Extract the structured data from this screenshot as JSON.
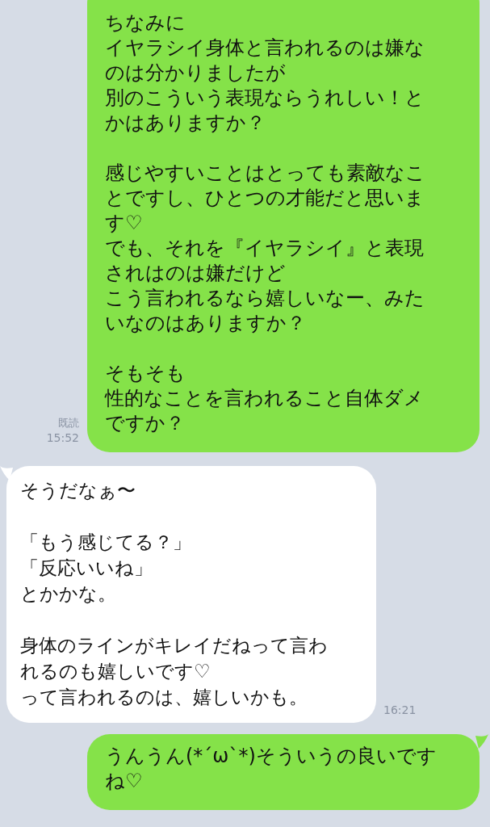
{
  "messages": [
    {
      "kind": "outgoing",
      "paragraphs": [
        [
          "ちなみに",
          "イヤラシイ身体と言われるのは嫌なのは分かりましたが",
          "別のこういう表現ならうれしい！とかはありますか？"
        ],
        [
          "感じやすいことはとっても素敵なことですし、ひとつの才能だと思います♡",
          "でも、それを『イヤラシイ』と表現されはのは嫌だけど",
          "こう言われるなら嬉しいなー、みたいなのはありますか？"
        ],
        [
          "そもそも",
          "性的なことを言われること自体ダメですか？"
        ]
      ],
      "read": "既読",
      "time": "15:52",
      "tail": false
    },
    {
      "kind": "incoming",
      "paragraphs": [
        [
          "そうだなぁ〜"
        ],
        [
          "「もう感じてる？」",
          "「反応いいね」",
          "とかかな。"
        ],
        [
          "身体のラインがキレイだねって言われるのも嬉しいです♡",
          "って言われるのは、嬉しいかも。"
        ]
      ],
      "time": "16:21",
      "tail": true
    },
    {
      "kind": "outgoing",
      "paragraphs": [
        [
          "うんうん(*´ω`*)そういうの良いですね♡"
        ]
      ],
      "tail": true
    }
  ]
}
